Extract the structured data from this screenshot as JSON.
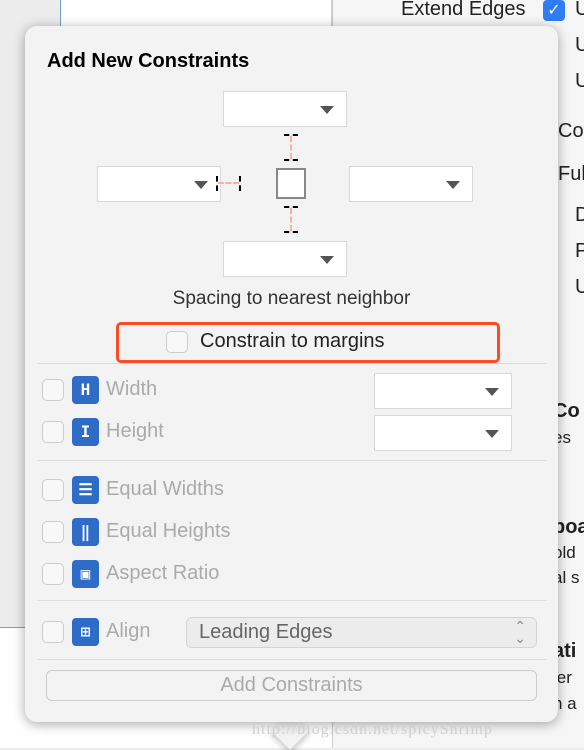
{
  "background": {
    "inspector_fragments": [
      "Extend Edges",
      "U",
      "U",
      "U",
      "Co",
      "Ful",
      "D",
      "P",
      "U",
      "Co",
      "es",
      "poa",
      "old",
      "al s",
      "ati",
      "ler",
      "h a"
    ]
  },
  "popover": {
    "title": "Add New Constraints",
    "spacing_label": "Spacing to nearest neighbor",
    "constrain_to_margins": {
      "label": "Constrain to margins",
      "checked": false,
      "highlight_color": "#ff4a2a"
    },
    "width": {
      "label": "Width",
      "checked": false,
      "icon": "width-icon"
    },
    "height": {
      "label": "Height",
      "checked": false,
      "icon": "height-icon"
    },
    "equal_widths": {
      "label": "Equal Widths",
      "checked": false
    },
    "equal_heights": {
      "label": "Equal Heights",
      "checked": false
    },
    "aspect_ratio": {
      "label": "Aspect Ratio",
      "checked": false
    },
    "align": {
      "label": "Align",
      "checked": false,
      "value": "Leading Edges"
    },
    "add_button": "Add Constraints"
  },
  "watermark": "http://blog.csdn.net/spicyShrimp",
  "colors": {
    "icon_blue": "#2f6cc7",
    "checkbox_checked": "#2f7cf6"
  }
}
